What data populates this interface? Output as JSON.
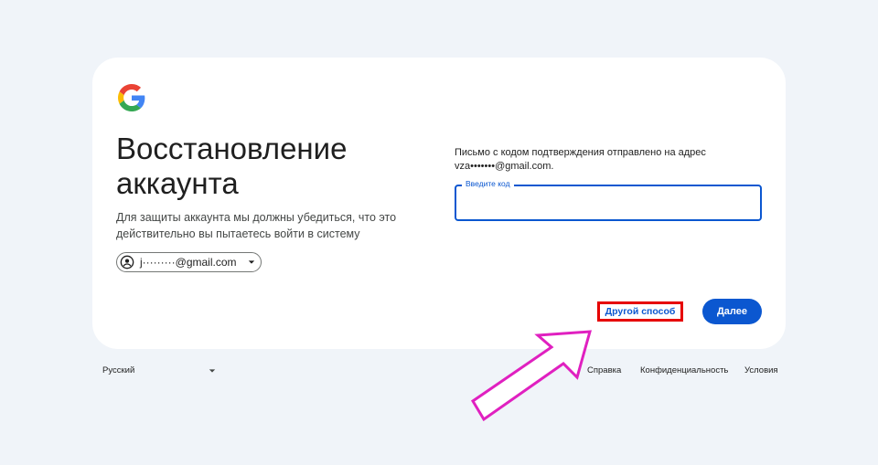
{
  "header": {
    "logo_icon": "google-g-icon"
  },
  "main": {
    "title": "Восстановление аккаунта",
    "subtitle": "Для защиты аккаунта мы должны убедиться, что это действительно вы пытаетесь войти в систему",
    "account_chip": {
      "email": "j·········@gmail.com",
      "avatar_icon": "account-circle-icon",
      "caret_icon": "caret-down-icon"
    },
    "message_line1": "Письмо с кодом подтверждения отправлено на адрес",
    "message_line2": "vza•••••••@gmail.com.",
    "code_field": {
      "label": "Введите код",
      "value": ""
    },
    "other_way_button": "Другой способ",
    "next_button": "Далее"
  },
  "footer": {
    "language": "Русский",
    "links": [
      "Справка",
      "Конфиденциальность",
      "Условия"
    ]
  },
  "colors": {
    "background": "#f0f4f9",
    "accent": "#0b57d0",
    "highlight_box": "#e60000",
    "annotation_arrow": "#e020c0"
  },
  "annotation": {
    "arrow_icon": "pink-arrow-icon"
  }
}
